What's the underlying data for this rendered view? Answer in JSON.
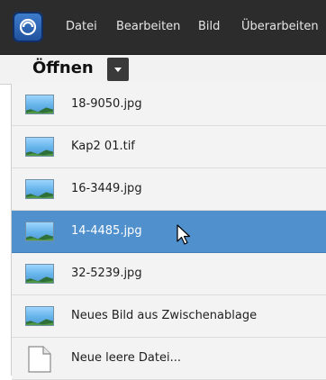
{
  "menubar": {
    "items": [
      "Datei",
      "Bearbeiten",
      "Bild",
      "Überarbeiten"
    ]
  },
  "toolbar": {
    "open_label": "Öffnen"
  },
  "recent_files": {
    "items": [
      {
        "label": "18-9050.jpg",
        "icon": "image-file-icon",
        "selected": false
      },
      {
        "label": "Kap2 01.tif",
        "icon": "image-file-icon",
        "selected": false
      },
      {
        "label": "16-3449.jpg",
        "icon": "image-file-icon",
        "selected": false
      },
      {
        "label": "14-4485.jpg",
        "icon": "image-file-icon",
        "selected": true
      },
      {
        "label": "32-5239.jpg",
        "icon": "image-file-icon",
        "selected": false
      },
      {
        "label": "Neues Bild aus Zwischenablage",
        "icon": "image-file-icon",
        "selected": false
      },
      {
        "label": "Neue leere Datei...",
        "icon": "blank-document-icon",
        "selected": false
      }
    ]
  },
  "colors": {
    "menubar": "#2c2c2c",
    "selection": "#4f90cd",
    "list_background": "#f3f3f3"
  }
}
